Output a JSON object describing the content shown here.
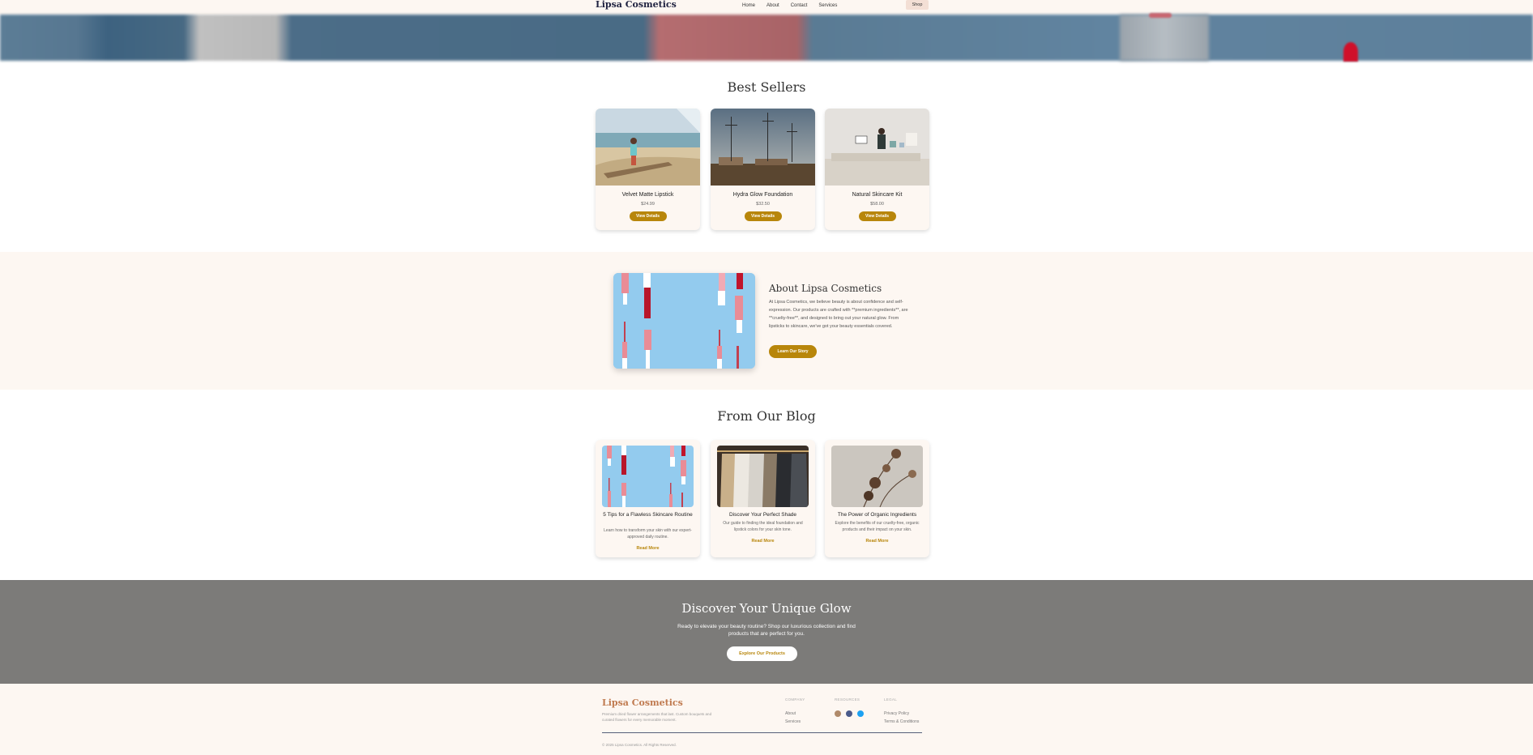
{
  "nav": {
    "logo": "Lipsa Cosmetics",
    "links": [
      "Home",
      "About",
      "Contact",
      "Services"
    ],
    "shop_label": "Shop"
  },
  "best_sellers": {
    "title": "Best Sellers",
    "products": [
      {
        "name": "Velvet Matte Lipstick",
        "price": "$24.99",
        "button": "View Details"
      },
      {
        "name": "Hydra Glow Foundation",
        "price": "$32.50",
        "button": "View Details"
      },
      {
        "name": "Natural Skincare Kit",
        "price": "$58.00",
        "button": "View Details"
      }
    ]
  },
  "about": {
    "title": "About Lipsa Cosmetics",
    "text": "At Lipsa Cosmetics, we believe beauty is about confidence and self-expression. Our products are crafted with **premium ingredients**, are **cruelty-free**, and designed to bring out your natural glow. From lipsticks to skincare, we've got your beauty essentials covered.",
    "button": "Learn Our Story"
  },
  "blog": {
    "title": "From Our Blog",
    "posts": [
      {
        "title": "5 Tips for a Flawless Skincare Routine",
        "excerpt": "Learn how to transform your skin with our expert-approved daily routine.",
        "link": "Read More"
      },
      {
        "title": "Discover Your Perfect Shade",
        "excerpt": "Our guide to finding the ideal foundation and lipstick colors for your skin tone.",
        "link": "Read More"
      },
      {
        "title": "The Power of Organic Ingredients",
        "excerpt": "Explore the benefits of our cruelty-free, organic products and their impact on your skin.",
        "link": "Read More"
      }
    ]
  },
  "cta": {
    "title": "Discover Your Unique Glow",
    "text": "Ready to elevate your beauty routine? Shop our luxurious collection and find products that are perfect for you.",
    "button": "Explore Our Products"
  },
  "footer": {
    "logo": "Lipsa Cosmetics",
    "tagline": "Premium dried flower arrangements that last. Custom bouquets and curated flowers for every memorable moment.",
    "company_heading": "COMPANY",
    "company_links": [
      "About",
      "Services"
    ],
    "resources_heading": "RESOURCES",
    "social_colors": [
      "#b08a6a",
      "#4a5a8a",
      "#1da1f2"
    ],
    "legal_heading": "LEGAL",
    "legal_links": [
      "Privacy Policy",
      "Terms & Conditions"
    ],
    "copyright": "© 2025 Lipsa Cosmetics. All Rights Reserved."
  },
  "colors": {
    "accent": "#b8860b",
    "nav_bg": "#fdf7f2",
    "cta_bg": "#7c7b79",
    "logo_dark": "#1f2240",
    "footer_logo": "#c07a4f"
  }
}
